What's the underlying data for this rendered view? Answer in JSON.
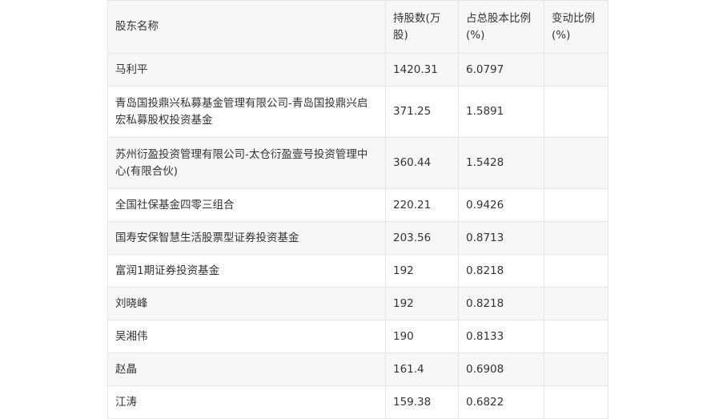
{
  "table": {
    "headers": {
      "name": "股东名称",
      "shares": "持股数(万股)",
      "ratio": "占总股本比例(%)",
      "change": "变动比例(%)"
    },
    "rows": [
      {
        "name": "马利平",
        "shares": "1420.31",
        "ratio": "6.0797",
        "change": ""
      },
      {
        "name": "青岛国投鼎兴私募基金管理有限公司-青岛国投鼎兴启宏私募股权投资基金",
        "shares": "371.25",
        "ratio": "1.5891",
        "change": ""
      },
      {
        "name": "苏州衍盈投资管理有限公司-太仓衍盈壹号投资管理中心(有限合伙)",
        "shares": "360.44",
        "ratio": "1.5428",
        "change": ""
      },
      {
        "name": "全国社保基金四零三组合",
        "shares": "220.21",
        "ratio": "0.9426",
        "change": ""
      },
      {
        "name": "国寿安保智慧生活股票型证券投资基金",
        "shares": "203.56",
        "ratio": "0.8713",
        "change": ""
      },
      {
        "name": "富润1期证券投资基金",
        "shares": "192",
        "ratio": "0.8218",
        "change": ""
      },
      {
        "name": "刘晓峰",
        "shares": "192",
        "ratio": "0.8218",
        "change": ""
      },
      {
        "name": "吴湘伟",
        "shares": "190",
        "ratio": "0.8133",
        "change": ""
      },
      {
        "name": "赵晶",
        "shares": "161.4",
        "ratio": "0.6908",
        "change": ""
      },
      {
        "name": "江涛",
        "shares": "159.38",
        "ratio": "0.6822",
        "change": ""
      }
    ]
  }
}
